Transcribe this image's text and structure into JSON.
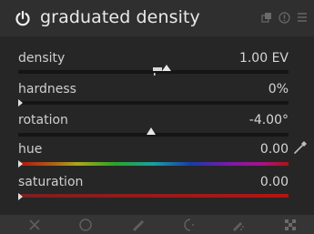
{
  "module": {
    "title": "graduated density",
    "icons": [
      "power-icon",
      "presets-icon",
      "reset-icon",
      "menu-icon"
    ]
  },
  "sliders": [
    {
      "label": "density",
      "value": "1.00 EV",
      "level": 0.55
    },
    {
      "label": "hardness",
      "value": "0%",
      "level": 0.0
    },
    {
      "label": "rotation",
      "value": "-4.00°",
      "level": 0.49
    },
    {
      "label": "hue",
      "value": "0.00",
      "level": 0.0
    },
    {
      "label": "saturation",
      "value": "0.00",
      "level": 0.0
    }
  ],
  "colors": {
    "accent": "#e9e9e9",
    "hue_gradient": [
      "#b01212",
      "#a8a818",
      "#2aa42a",
      "#18a0a0",
      "#1a3aaa",
      "#7a1aa8",
      "#b01212"
    ],
    "saturation_gradient": [
      "#7a2020",
      "#b41414"
    ]
  },
  "toolbar": {
    "icons": [
      "cancel-icon",
      "ellipse-icon",
      "brush-icon",
      "circle-icon",
      "path-icon",
      "checkerboard-icon"
    ]
  }
}
